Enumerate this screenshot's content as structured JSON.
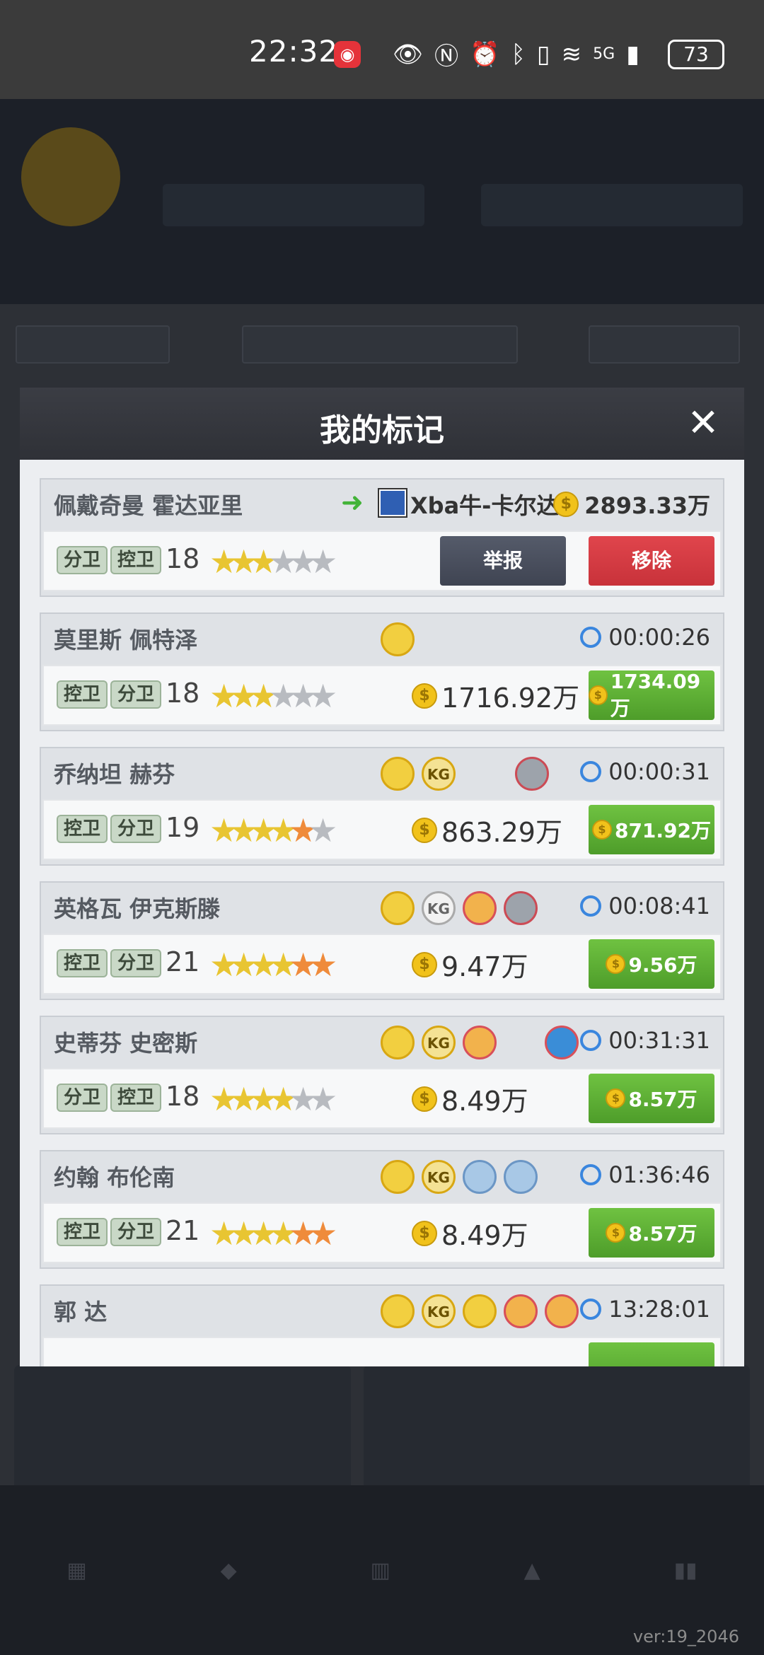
{
  "status_bar": {
    "time": "22:32",
    "battery": "73",
    "icons": [
      "eye-icon",
      "nfc-icon",
      "alarm-icon",
      "bluetooth-icon",
      "vibrate-icon",
      "wifi-icon",
      "signal-5g-icon"
    ],
    "network": "5G"
  },
  "modal": {
    "title": "我的标记",
    "close_symbol": "✕"
  },
  "cards": [
    {
      "name": "佩戴奇曼 霍达亚里",
      "seller": "Xba牛-卡尔达",
      "price": "2893.33万",
      "positions": [
        "分卫",
        "控卫"
      ],
      "level": "18",
      "stars": [
        "g",
        "g",
        "g",
        "s",
        "s",
        "s"
      ],
      "report_label": "举报",
      "remove_label": "移除"
    },
    {
      "name": "莫里斯 佩特泽",
      "timer": "00:00:26",
      "positions": [
        "控卫",
        "分卫"
      ],
      "level": "18",
      "stars": [
        "g",
        "g",
        "g",
        "s",
        "s",
        "s"
      ],
      "price": "1716.92万",
      "buy_price": "1734.09万",
      "badges": [
        "gold"
      ]
    },
    {
      "name": "乔纳坦 赫芬",
      "timer": "00:00:31",
      "positions": [
        "控卫",
        "分卫"
      ],
      "level": "19",
      "stars": [
        "g",
        "g",
        "g",
        "g",
        "o",
        "s"
      ],
      "price": "863.29万",
      "buy_price": "871.92万",
      "badges": [
        "gold",
        "kg",
        "gray"
      ]
    },
    {
      "name": "英格瓦 伊克斯滕",
      "timer": "00:08:41",
      "positions": [
        "控卫",
        "分卫"
      ],
      "level": "21",
      "stars": [
        "g",
        "g",
        "g",
        "g",
        "o",
        "o"
      ],
      "price": "9.47万",
      "buy_price": "9.56万",
      "badges": [
        "gold",
        "wkg",
        "red",
        "gray"
      ]
    },
    {
      "name": "史蒂芬 史密斯",
      "timer": "00:31:31",
      "positions": [
        "分卫",
        "控卫"
      ],
      "level": "18",
      "stars": [
        "g",
        "g",
        "g",
        "g",
        "s",
        "s"
      ],
      "price": "8.49万",
      "buy_price": "8.57万",
      "badges": [
        "gold",
        "kg",
        "red",
        "blue"
      ]
    },
    {
      "name": "约翰 布伦南",
      "timer": "01:36:46",
      "positions": [
        "控卫",
        "分卫"
      ],
      "level": "21",
      "stars": [
        "g",
        "g",
        "g",
        "g",
        "o",
        "o"
      ],
      "price": "8.49万",
      "buy_price": "8.57万",
      "badges": [
        "gold",
        "kg",
        "lblue",
        "lblue"
      ]
    },
    {
      "name": "郭 达",
      "timer": "13:28:01",
      "badges": [
        "gold",
        "kg",
        "gold",
        "red",
        "red"
      ]
    }
  ],
  "badge_text": {
    "kg": "KG",
    "wkg": "KG"
  },
  "coin_symbol": "$",
  "star_glyph": "★",
  "version": "ver:19_2046"
}
